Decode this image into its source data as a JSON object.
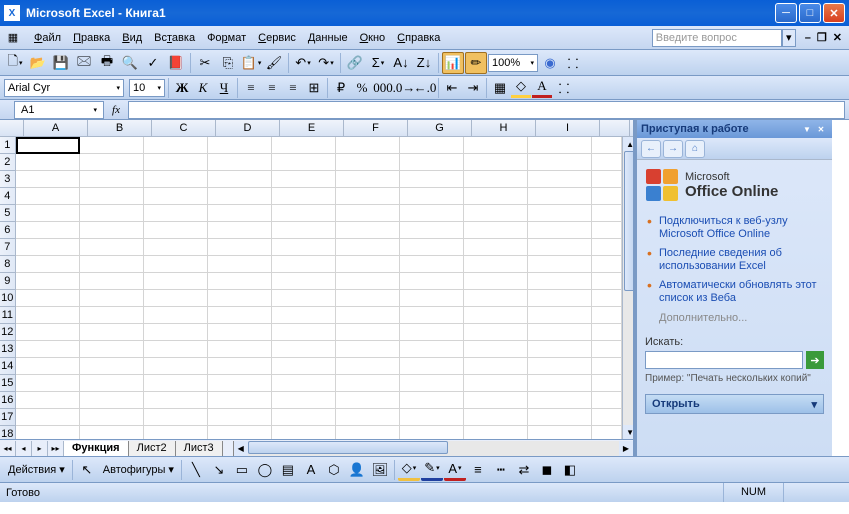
{
  "title": "Microsoft Excel - Книга1",
  "menus": [
    "Файл",
    "Правка",
    "Вид",
    "Вставка",
    "Формат",
    "Сервис",
    "Данные",
    "Окно",
    "Справка"
  ],
  "menu_underlines": [
    0,
    0,
    0,
    2,
    2,
    0,
    0,
    0,
    0
  ],
  "search_placeholder": "Введите вопрос",
  "zoom": "100%",
  "font_name": "Arial Cyr",
  "font_size": "10",
  "namebox": "A1",
  "columns": [
    "A",
    "B",
    "C",
    "D",
    "E",
    "F",
    "G",
    "H",
    "I",
    ""
  ],
  "rows": [
    1,
    2,
    3,
    4,
    5,
    6,
    7,
    8,
    9,
    10,
    11,
    12,
    13,
    14,
    15,
    16,
    17,
    18
  ],
  "sheets": [
    "Функция",
    "Лист2",
    "Лист3"
  ],
  "active_sheet": 0,
  "taskpane": {
    "title": "Приступая к работе",
    "office_brand_small": "Microsoft",
    "office_brand": "Office Online",
    "links": [
      "Подключиться к веб-узлу Microsoft Office Online",
      "Последние сведения об использовании Excel",
      "Автоматически обновлять этот список из Веба"
    ],
    "more": "Дополнительно...",
    "search_label": "Искать:",
    "example": "Пример: \"Печать нескольких копий\"",
    "open": "Открыть"
  },
  "drawbar": {
    "actions": "Действия",
    "autoshapes": "Автофигуры"
  },
  "status": {
    "ready": "Готово",
    "num": "NUM"
  }
}
